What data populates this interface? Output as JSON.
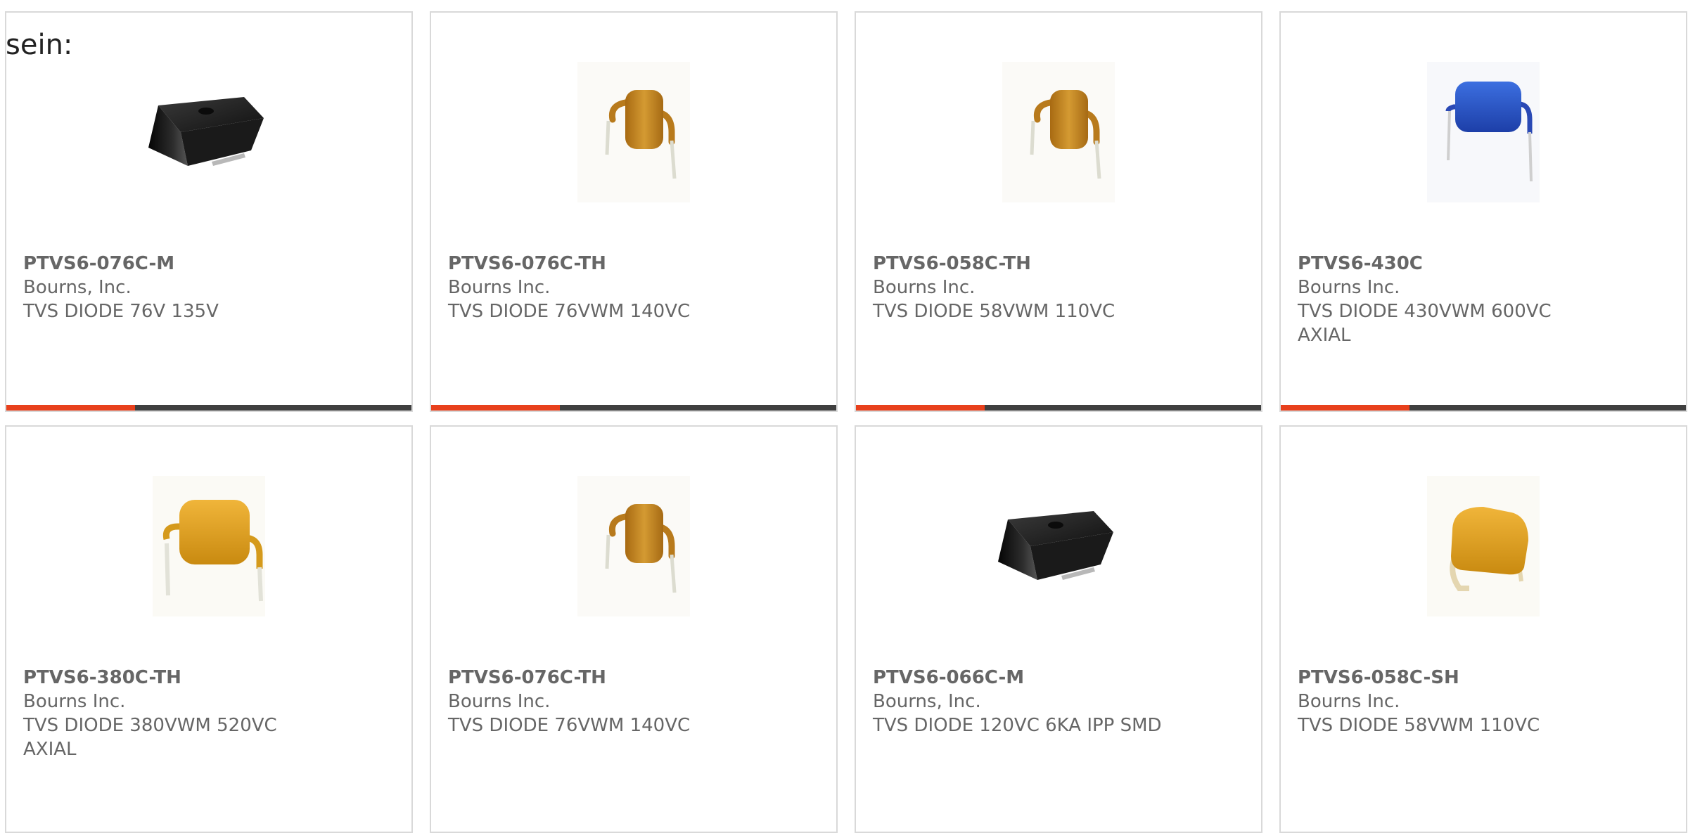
{
  "heading": "sein:",
  "colors": {
    "accent": "#e8401c",
    "bar_dark": "#3f3f3f",
    "border": "#d9d9d9",
    "text": "#666666"
  },
  "products": [
    {
      "part": "PTVS6-076C-M",
      "maker": "Bourns, Inc.",
      "desc1": "TVS DIODE 76V 135V",
      "desc2": "",
      "image": "black-smd-package"
    },
    {
      "part": "PTVS6-076C-TH",
      "maker": "Bourns Inc.",
      "desc1": "TVS DIODE 76VWM 140VC",
      "desc2": "",
      "image": "orange-th-diode"
    },
    {
      "part": "PTVS6-058C-TH",
      "maker": "Bourns Inc.",
      "desc1": "TVS DIODE 58VWM 110VC",
      "desc2": "",
      "image": "orange-th-diode"
    },
    {
      "part": "PTVS6-430C",
      "maker": "Bourns Inc.",
      "desc1": "TVS DIODE 430VWM 600VC",
      "desc2": "AXIAL",
      "image": "blue-axial-diode"
    },
    {
      "part": "PTVS6-380C-TH",
      "maker": "Bourns Inc.",
      "desc1": "TVS DIODE 380VWM 520VC",
      "desc2": "AXIAL",
      "image": "yellow-axial-diode"
    },
    {
      "part": "PTVS6-076C-TH",
      "maker": "Bourns Inc.",
      "desc1": "TVS DIODE 76VWM 140VC",
      "desc2": "",
      "image": "orange-th-diode"
    },
    {
      "part": "PTVS6-066C-M",
      "maker": "Bourns, Inc.",
      "desc1": "TVS DIODE 120VC 6KA IPP SMD",
      "desc2": "",
      "image": "black-smd-package"
    },
    {
      "part": "PTVS6-058C-SH",
      "maker": "Bourns Inc.",
      "desc1": "TVS DIODE 58VWM 110VC",
      "desc2": "",
      "image": "yellow-smd-diode"
    }
  ]
}
